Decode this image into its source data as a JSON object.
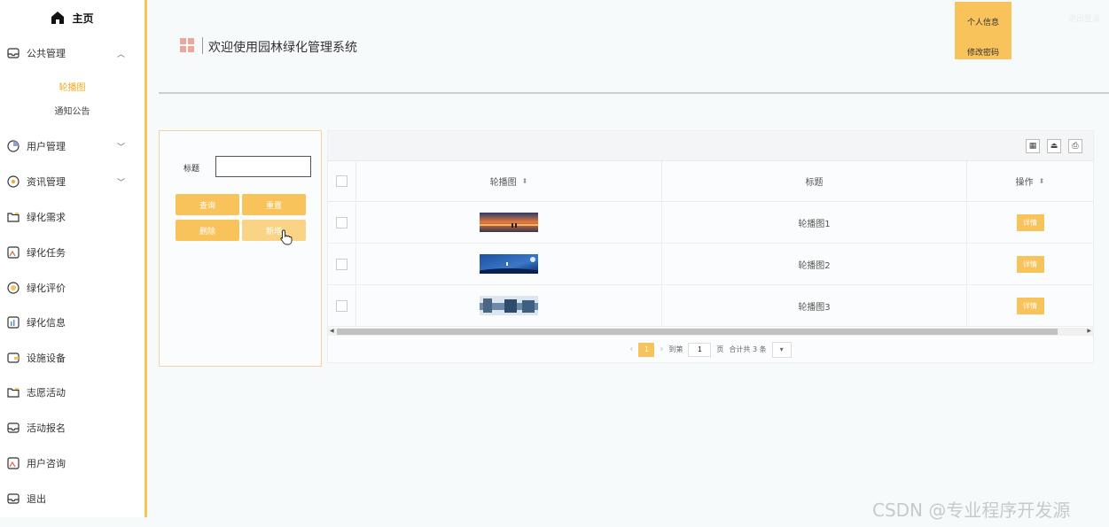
{
  "sidebar": {
    "home_label": "主页",
    "public_mgmt": {
      "label": "公共管理",
      "sub": [
        "轮播图",
        "通知公告"
      ]
    },
    "items": [
      {
        "label": "用户管理",
        "icon": "clock-icon",
        "has_children": true
      },
      {
        "label": "资讯管理",
        "icon": "info-circle-icon",
        "has_children": true
      },
      {
        "label": "绿化需求",
        "icon": "folder-icon"
      },
      {
        "label": "绿化任务",
        "icon": "image-icon"
      },
      {
        "label": "绿化评价",
        "icon": "star-circle-icon"
      },
      {
        "label": "绿化信息",
        "icon": "chart-icon"
      },
      {
        "label": "设施设备",
        "icon": "wallet-icon"
      },
      {
        "label": "志愿活动",
        "icon": "folder-icon"
      },
      {
        "label": "活动报名",
        "icon": "inbox-icon"
      },
      {
        "label": "用户咨询",
        "icon": "image-icon"
      },
      {
        "label": "退出",
        "icon": "inbox-icon"
      }
    ]
  },
  "header": {
    "title": "欢迎使用园林绿化管理系统",
    "profile_label": "个人信息",
    "password_label": "修改密码",
    "faint_label": "退出登录"
  },
  "search": {
    "label": "标题",
    "value": "",
    "query_label": "查询",
    "reset_label": "重置",
    "delete_label": "删除",
    "add_label": "新增"
  },
  "table": {
    "columns": [
      "轮播图",
      "标题",
      "操作"
    ],
    "rows": [
      {
        "title": "轮播图1",
        "action": "详情"
      },
      {
        "title": "轮播图2",
        "action": "详情"
      },
      {
        "title": "轮播图3",
        "action": "详情"
      }
    ]
  },
  "pagination": {
    "current": "1",
    "goto_label": "到第",
    "goto_value": "1",
    "page_label": "页",
    "total_label": "合计共 3 条"
  },
  "watermark": "CSDN @专业程序开发源",
  "colors": {
    "accent": "#f7c35a",
    "active_text": "#f3a81a"
  }
}
